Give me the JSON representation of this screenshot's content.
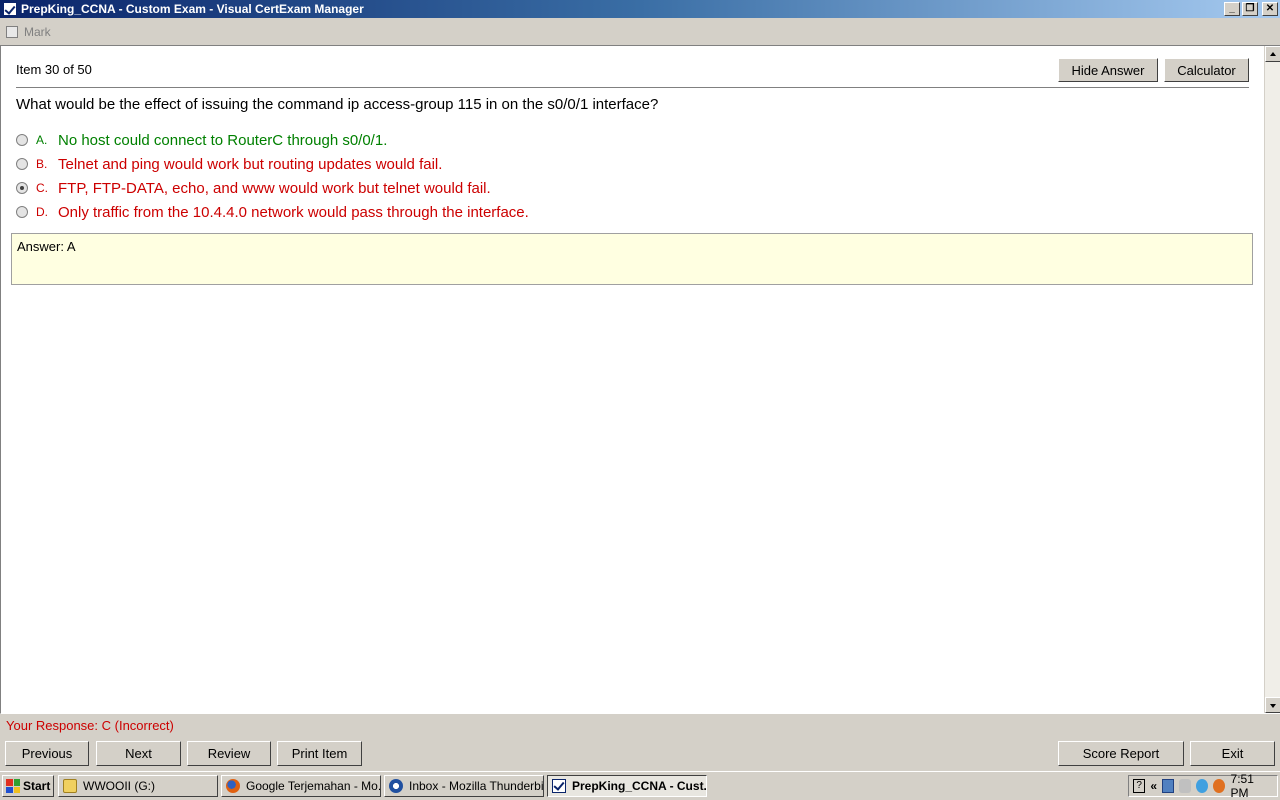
{
  "window": {
    "title": "PrepKing_CCNA - Custom Exam - Visual CertExam Manager",
    "controls": [
      "_",
      "❐",
      "✕"
    ]
  },
  "mark": {
    "label": "Mark"
  },
  "header": {
    "item_counter": "Item 30 of 50",
    "hide_answer_label": "Hide Answer",
    "calculator_label": "Calculator"
  },
  "question": {
    "text": "What would be the effect of issuing the command ip access-group 115 in on the s0/0/1 interface?"
  },
  "options": [
    {
      "letter": "A.",
      "text": "No host could connect to RouterC through s0/0/1.",
      "selected": false,
      "status": "correct"
    },
    {
      "letter": "B.",
      "text": "Telnet and ping would work but routing updates would fail.",
      "selected": false,
      "status": "wrong"
    },
    {
      "letter": "C.",
      "text": "FTP, FTP-DATA, echo, and www would work but telnet would fail.",
      "selected": true,
      "status": "wrong"
    },
    {
      "letter": "D.",
      "text": "Only traffic from the 10.4.4.0 network would pass through the interface.",
      "selected": false,
      "status": "wrong"
    }
  ],
  "answer": {
    "text": "Answer: A"
  },
  "response": {
    "text": "Your Response: C (Incorrect)"
  },
  "nav": {
    "previous": "Previous",
    "next": "Next",
    "review": "Review",
    "print_item": "Print Item",
    "score_report": "Score Report",
    "exit": "Exit"
  },
  "taskbar": {
    "start": "Start",
    "tasks": [
      {
        "label": "WWOOII (G:)",
        "icon": "folder-icon"
      },
      {
        "label": "Google Terjemahan - Mo...",
        "icon": "firefox-icon"
      },
      {
        "label": "Inbox - Mozilla Thunderbird",
        "icon": "thunderbird-icon"
      },
      {
        "label": "PrepKing_CCNA - Cust...",
        "icon": "certexam-icon",
        "active": true
      }
    ],
    "clock": "7:51 PM"
  },
  "colors": {
    "correct": "#008000",
    "wrong": "#cc0000",
    "answer_bg": "#ffffe1",
    "titlebar": "#0a246a"
  }
}
